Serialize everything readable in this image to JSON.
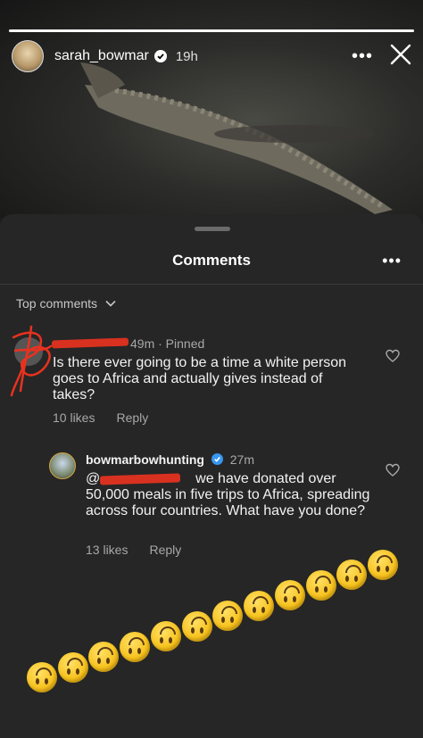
{
  "story": {
    "username": "sarah_bowmar",
    "time": "19h",
    "progress": 1.0,
    "icons": {
      "verified": "verified-badge-icon",
      "more": "more-horizontal-icon",
      "close": "close-icon"
    }
  },
  "sheet": {
    "title": "Comments",
    "sort_label": "Top comments"
  },
  "comments": [
    {
      "username": "",
      "time": "49m",
      "pinned": "· Pinned",
      "text": "Is there ever going to be a time a white person goes to Africa and actually gives instead of takes?",
      "likes": "10 likes",
      "reply": "Reply"
    },
    {
      "username": "bowmarbowhunting",
      "time": "27m",
      "mention": "@",
      "text": "we have donated over 50,000 meals in five trips to Africa, spreading across four countries. What have you done?",
      "likes": "13 likes",
      "reply": "Reply"
    }
  ],
  "emoji_count": 12,
  "colors": {
    "sheet": "#262626",
    "verified": "#3797f0",
    "redaction": "#e8321f",
    "emoji": "#f7c21c"
  }
}
